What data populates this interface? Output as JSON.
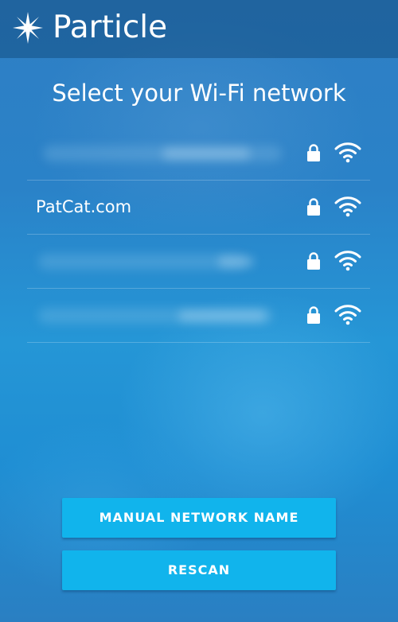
{
  "header": {
    "brand": "Particle",
    "logo_icon": "particle-star-icon"
  },
  "title": "Select your Wi-Fi network",
  "networks": [
    {
      "ssid": "",
      "obscured": true,
      "secured": true,
      "signal": "full"
    },
    {
      "ssid": "PatCat.com",
      "obscured": false,
      "secured": true,
      "signal": "full"
    },
    {
      "ssid": "",
      "obscured": true,
      "secured": true,
      "signal": "full"
    },
    {
      "ssid": "",
      "obscured": true,
      "secured": true,
      "signal": "full"
    }
  ],
  "icons": {
    "lock": "lock-icon",
    "wifi": "wifi-icon"
  },
  "buttons": {
    "manual": "MANUAL NETWORK NAME",
    "rescan": "RESCAN"
  },
  "colors": {
    "button": "#11b4ec",
    "header": "#1e5a8e",
    "background": "#2a8acd"
  }
}
